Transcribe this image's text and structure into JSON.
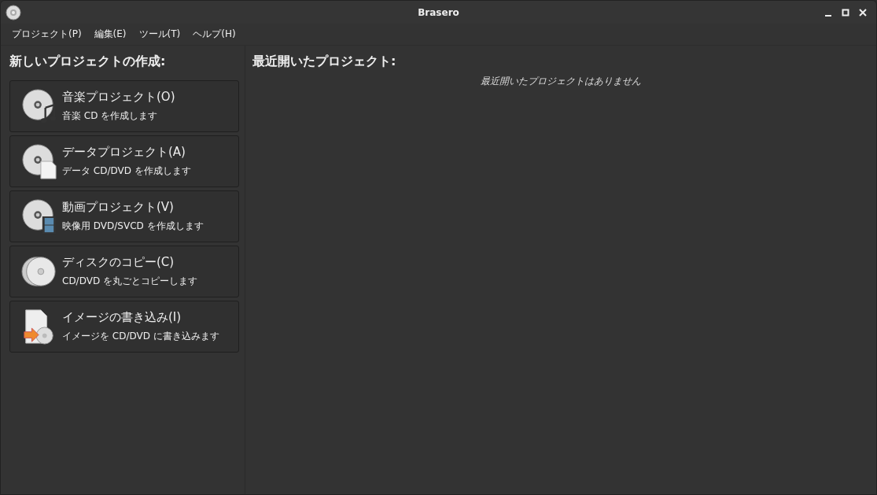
{
  "window": {
    "title": "Brasero"
  },
  "menu": [
    "プロジェクト(P)",
    "編集(E)",
    "ツール(T)",
    "ヘルプ(H)"
  ],
  "new_project": {
    "heading": "新しいプロジェクトの作成:",
    "items": [
      {
        "kind": "audio",
        "title": "音楽プロジェクト(O)",
        "description": "音楽 CD を作成します"
      },
      {
        "kind": "data",
        "title": "データプロジェクト(A)",
        "description": "データ CD/DVD を作成します"
      },
      {
        "kind": "video",
        "title": "動画プロジェクト(V)",
        "description": "映像用 DVD/SVCD を作成します"
      },
      {
        "kind": "copy",
        "title": "ディスクのコピー(C)",
        "description": "CD/DVD を丸ごとコピーします"
      },
      {
        "kind": "image",
        "title": "イメージの書き込み(I)",
        "description": "イメージを CD/DVD に書き込みます"
      }
    ]
  },
  "recent": {
    "heading": "最近開いたプロジェクト:",
    "empty_message": "最近開いたプロジェクトはありません"
  }
}
